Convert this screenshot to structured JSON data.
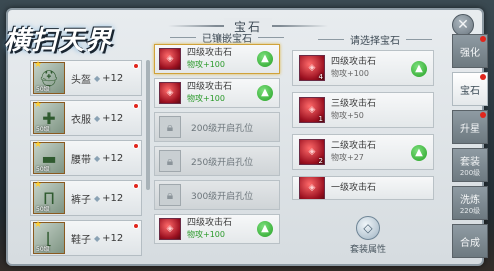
{
  "window": {
    "title": "宝石"
  },
  "logo": {
    "text": "横扫天界"
  },
  "equipment": [
    {
      "name": "头盔",
      "plus": "+12",
      "level": "50级",
      "icon": "helmet-icon"
    },
    {
      "name": "衣服",
      "plus": "+12",
      "level": "50级",
      "icon": "armor-icon"
    },
    {
      "name": "腰带",
      "plus": "+12",
      "level": "50级",
      "icon": "belt-icon"
    },
    {
      "name": "裤子",
      "plus": "+12",
      "level": "50级",
      "icon": "pants-icon"
    },
    {
      "name": "鞋子",
      "plus": "+12",
      "level": "50级",
      "icon": "shoes-icon"
    }
  ],
  "equipped": {
    "header": "已镶嵌宝石",
    "slots": [
      {
        "type": "gem",
        "name": "四级攻击石",
        "attr": "物攻+100"
      },
      {
        "type": "gem",
        "name": "四级攻击石",
        "attr": "物攻+100"
      },
      {
        "type": "locked",
        "text": "200级开启孔位"
      },
      {
        "type": "locked",
        "text": "250级开启孔位"
      },
      {
        "type": "locked",
        "text": "300级开启孔位"
      },
      {
        "type": "gem",
        "name": "四级攻击石",
        "attr": "物攻+100"
      }
    ]
  },
  "choose": {
    "header": "请选择宝石",
    "items": [
      {
        "name": "四级攻击石",
        "attr": "物攻+100",
        "count": "4"
      },
      {
        "name": "三级攻击石",
        "attr": "物攻+50",
        "count": "1"
      },
      {
        "name": "二级攻击石",
        "attr": "物攻+27",
        "count": "2"
      },
      {
        "name": "一级攻击石",
        "attr": "",
        "count": ""
      }
    ],
    "set_attr_label": "套装属性"
  },
  "tabs": [
    {
      "label": "强化",
      "sub": ""
    },
    {
      "label": "宝石",
      "sub": ""
    },
    {
      "label": "升星",
      "sub": ""
    },
    {
      "label": "套装",
      "sub": "200级"
    },
    {
      "label": "洗炼",
      "sub": "220级"
    },
    {
      "label": "合成",
      "sub": ""
    }
  ],
  "colors": {
    "accent": "#2a9a2a",
    "badge": "#e0261d"
  }
}
